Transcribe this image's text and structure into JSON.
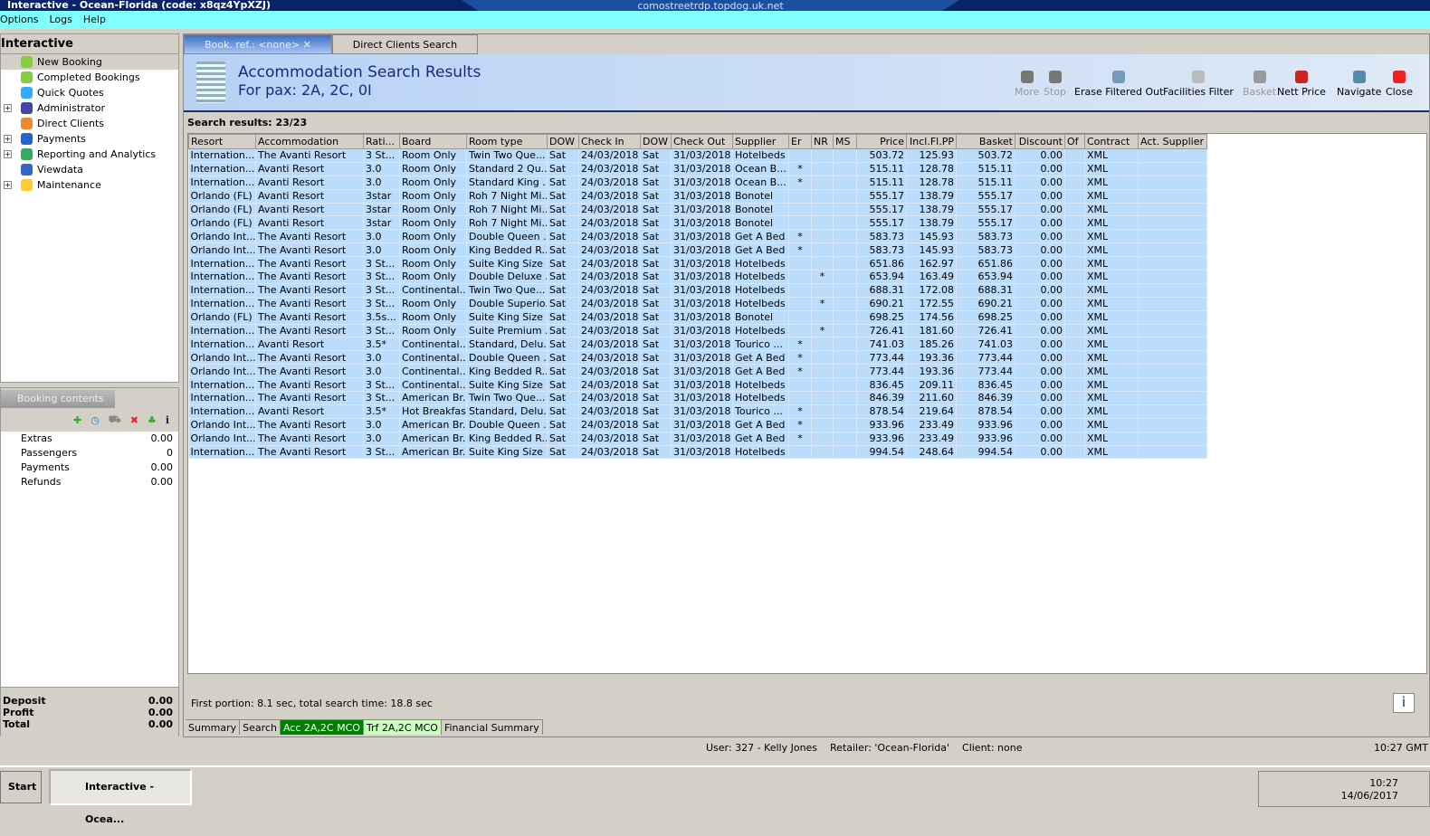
{
  "window": {
    "title": "Interactive - Ocean-Florida (code: x8qz4YpXZJ)",
    "rdp_host": "comostreetrdp.topdog.uk.net"
  },
  "menu": [
    "Options",
    "Logs",
    "Help"
  ],
  "left_panel": {
    "title": "Interactive",
    "items": [
      {
        "label": "New Booking",
        "expand": false
      },
      {
        "label": "Completed Bookings",
        "expand": false
      },
      {
        "label": "Quick Quotes",
        "expand": false
      },
      {
        "label": "Administrator",
        "expand": true
      },
      {
        "label": "Direct Clients",
        "expand": false
      },
      {
        "label": "Payments",
        "expand": true
      },
      {
        "label": "Reporting and Analytics",
        "expand": true
      },
      {
        "label": "Viewdata",
        "expand": false
      },
      {
        "label": "Maintenance",
        "expand": true
      }
    ]
  },
  "booking_contents": {
    "title": "Booking contents",
    "rows": [
      {
        "label": "Extras",
        "value": "0.00"
      },
      {
        "label": "Passengers",
        "value": "0"
      },
      {
        "label": "Payments",
        "value": "0.00"
      },
      {
        "label": "Refunds",
        "value": "0.00"
      }
    ],
    "footer": [
      {
        "label": "Deposit",
        "value": "0.00"
      },
      {
        "label": "Profit",
        "value": "0.00"
      },
      {
        "label": "Total",
        "value": "0.00"
      }
    ]
  },
  "tabs": [
    {
      "label": "Book. ref.: <none>"
    },
    {
      "label": "Direct Clients Search"
    }
  ],
  "header": {
    "title": "Accommodation Search Results",
    "subtitle": "For pax: 2A, 2C, 0I"
  },
  "toolbar": [
    {
      "label": "More",
      "disabled": true
    },
    {
      "label": "Stop",
      "disabled": true
    },
    {
      "label": "Erase Filtered Out",
      "disabled": false
    },
    {
      "label": "Facilities Filter",
      "disabled": false
    },
    {
      "label": "Basket",
      "disabled": true
    },
    {
      "label": "Nett Price",
      "disabled": false
    },
    {
      "label": "Navigate",
      "disabled": false
    },
    {
      "label": "Close",
      "disabled": false
    }
  ],
  "search_results": "Search results: 23/23",
  "columns": [
    "Resort",
    "Accommodation",
    "Rati...",
    "Board",
    "Room type",
    "DOW",
    "Check In",
    "DOW",
    "Check Out",
    "Supplier",
    "Er",
    "NR",
    "MS",
    "Price",
    "Incl.Fl.PP",
    "Basket",
    "Discount",
    "Of",
    "Contract",
    "Act. Supplier"
  ],
  "rows": [
    [
      "Internation...",
      "The Avanti Resort",
      "3 St...",
      "Room Only",
      "Twin Two Que...",
      "Sat",
      "24/03/2018",
      "Sat",
      "31/03/2018",
      "Hotelbeds",
      "",
      "",
      "",
      "503.72",
      "125.93",
      "503.72",
      "0.00",
      "",
      "XML",
      ""
    ],
    [
      "Internation...",
      "Avanti Resort",
      "3.0",
      "Room Only",
      "Standard 2 Qu...",
      "Sat",
      "24/03/2018",
      "Sat",
      "31/03/2018",
      "Ocean B...",
      "*",
      "",
      "",
      "515.11",
      "128.78",
      "515.11",
      "0.00",
      "",
      "XML",
      ""
    ],
    [
      "Internation...",
      "Avanti Resort",
      "3.0",
      "Room Only",
      "Standard King ...",
      "Sat",
      "24/03/2018",
      "Sat",
      "31/03/2018",
      "Ocean B...",
      "*",
      "",
      "",
      "515.11",
      "128.78",
      "515.11",
      "0.00",
      "",
      "XML",
      ""
    ],
    [
      "Orlando (FL)",
      "Avanti Resort",
      "3star",
      "Room Only",
      "Roh 7 Night Mi...",
      "Sat",
      "24/03/2018",
      "Sat",
      "31/03/2018",
      "Bonotel",
      "",
      "",
      "",
      "555.17",
      "138.79",
      "555.17",
      "0.00",
      "",
      "XML",
      ""
    ],
    [
      "Orlando (FL)",
      "Avanti Resort",
      "3star",
      "Room Only",
      "Roh 7 Night Mi...",
      "Sat",
      "24/03/2018",
      "Sat",
      "31/03/2018",
      "Bonotel",
      "",
      "",
      "",
      "555.17",
      "138.79",
      "555.17",
      "0.00",
      "",
      "XML",
      ""
    ],
    [
      "Orlando (FL)",
      "Avanti Resort",
      "3star",
      "Room Only",
      "Roh 7 Night Mi...",
      "Sat",
      "24/03/2018",
      "Sat",
      "31/03/2018",
      "Bonotel",
      "",
      "",
      "",
      "555.17",
      "138.79",
      "555.17",
      "0.00",
      "",
      "XML",
      ""
    ],
    [
      "Orlando Int...",
      "The Avanti Resort",
      "3.0",
      "Room Only",
      "Double Queen ...",
      "Sat",
      "24/03/2018",
      "Sat",
      "31/03/2018",
      "Get A Bed",
      "*",
      "",
      "",
      "583.73",
      "145.93",
      "583.73",
      "0.00",
      "",
      "XML",
      ""
    ],
    [
      "Orlando Int...",
      "The Avanti Resort",
      "3.0",
      "Room Only",
      "King Bedded R...",
      "Sat",
      "24/03/2018",
      "Sat",
      "31/03/2018",
      "Get A Bed",
      "*",
      "",
      "",
      "583.73",
      "145.93",
      "583.73",
      "0.00",
      "",
      "XML",
      ""
    ],
    [
      "Internation...",
      "The Avanti Resort",
      "3 St...",
      "Room Only",
      "Suite King Size ...",
      "Sat",
      "24/03/2018",
      "Sat",
      "31/03/2018",
      "Hotelbeds",
      "",
      "",
      "",
      "651.86",
      "162.97",
      "651.86",
      "0.00",
      "",
      "XML",
      ""
    ],
    [
      "Internation...",
      "The Avanti Resort",
      "3 St...",
      "Room Only",
      "Double Deluxe ...",
      "Sat",
      "24/03/2018",
      "Sat",
      "31/03/2018",
      "Hotelbeds",
      "",
      "*",
      "",
      "653.94",
      "163.49",
      "653.94",
      "0.00",
      "",
      "XML",
      ""
    ],
    [
      "Internation...",
      "The Avanti Resort",
      "3 St...",
      "Continental...",
      "Twin Two Que...",
      "Sat",
      "24/03/2018",
      "Sat",
      "31/03/2018",
      "Hotelbeds",
      "",
      "",
      "",
      "688.31",
      "172.08",
      "688.31",
      "0.00",
      "",
      "XML",
      ""
    ],
    [
      "Internation...",
      "The Avanti Resort",
      "3 St...",
      "Room Only",
      "Double Superio...",
      "Sat",
      "24/03/2018",
      "Sat",
      "31/03/2018",
      "Hotelbeds",
      "",
      "*",
      "",
      "690.21",
      "172.55",
      "690.21",
      "0.00",
      "",
      "XML",
      ""
    ],
    [
      "Orlando (FL)",
      "The Avanti Resort",
      "3.5s...",
      "Room Only",
      "Suite King Size ...",
      "Sat",
      "24/03/2018",
      "Sat",
      "31/03/2018",
      "Bonotel",
      "",
      "",
      "",
      "698.25",
      "174.56",
      "698.25",
      "0.00",
      "",
      "XML",
      ""
    ],
    [
      "Internation...",
      "The Avanti Resort",
      "3 St...",
      "Room Only",
      "Suite Premium ...",
      "Sat",
      "24/03/2018",
      "Sat",
      "31/03/2018",
      "Hotelbeds",
      "",
      "*",
      "",
      "726.41",
      "181.60",
      "726.41",
      "0.00",
      "",
      "XML",
      ""
    ],
    [
      "Internation...",
      "Avanti Resort",
      "3.5*",
      "Continental...",
      "Standard, Delu...",
      "Sat",
      "24/03/2018",
      "Sat",
      "31/03/2018",
      "Tourico ...",
      "*",
      "",
      "",
      "741.03",
      "185.26",
      "741.03",
      "0.00",
      "",
      "XML",
      ""
    ],
    [
      "Orlando Int...",
      "The Avanti Resort",
      "3.0",
      "Continental...",
      "Double Queen ...",
      "Sat",
      "24/03/2018",
      "Sat",
      "31/03/2018",
      "Get A Bed",
      "*",
      "",
      "",
      "773.44",
      "193.36",
      "773.44",
      "0.00",
      "",
      "XML",
      ""
    ],
    [
      "Orlando Int...",
      "The Avanti Resort",
      "3.0",
      "Continental...",
      "King Bedded R...",
      "Sat",
      "24/03/2018",
      "Sat",
      "31/03/2018",
      "Get A Bed",
      "*",
      "",
      "",
      "773.44",
      "193.36",
      "773.44",
      "0.00",
      "",
      "XML",
      ""
    ],
    [
      "Internation...",
      "The Avanti Resort",
      "3 St...",
      "Continental...",
      "Suite King Size ...",
      "Sat",
      "24/03/2018",
      "Sat",
      "31/03/2018",
      "Hotelbeds",
      "",
      "",
      "",
      "836.45",
      "209.11",
      "836.45",
      "0.00",
      "",
      "XML",
      ""
    ],
    [
      "Internation...",
      "The Avanti Resort",
      "3 St...",
      "American Br...",
      "Twin Two Que...",
      "Sat",
      "24/03/2018",
      "Sat",
      "31/03/2018",
      "Hotelbeds",
      "",
      "",
      "",
      "846.39",
      "211.60",
      "846.39",
      "0.00",
      "",
      "XML",
      ""
    ],
    [
      "Internation...",
      "Avanti Resort",
      "3.5*",
      "Hot Breakfast",
      "Standard, Delu...",
      "Sat",
      "24/03/2018",
      "Sat",
      "31/03/2018",
      "Tourico ...",
      "*",
      "",
      "",
      "878.54",
      "219.64",
      "878.54",
      "0.00",
      "",
      "XML",
      ""
    ],
    [
      "Orlando Int...",
      "The Avanti Resort",
      "3.0",
      "American Br...",
      "Double Queen ...",
      "Sat",
      "24/03/2018",
      "Sat",
      "31/03/2018",
      "Get A Bed",
      "*",
      "",
      "",
      "933.96",
      "233.49",
      "933.96",
      "0.00",
      "",
      "XML",
      ""
    ],
    [
      "Orlando Int...",
      "The Avanti Resort",
      "3.0",
      "American Br...",
      "King Bedded R...",
      "Sat",
      "24/03/2018",
      "Sat",
      "31/03/2018",
      "Get A Bed",
      "*",
      "",
      "",
      "933.96",
      "233.49",
      "933.96",
      "0.00",
      "",
      "XML",
      ""
    ],
    [
      "Internation...",
      "The Avanti Resort",
      "3 St...",
      "American Br...",
      "Suite King Size ...",
      "Sat",
      "24/03/2018",
      "Sat",
      "31/03/2018",
      "Hotelbeds",
      "",
      "",
      "",
      "994.54",
      "248.64",
      "994.54",
      "0.00",
      "",
      "XML",
      ""
    ]
  ],
  "timing": "First portion: 8.1 sec, total search time: 18.8 sec",
  "bottom_tabs": [
    {
      "label": "Summary"
    },
    {
      "label": "Search"
    },
    {
      "label": "Acc 2A,2C MCO",
      "color": "#008000"
    },
    {
      "label": "Trf 2A,2C MCO",
      "color": "#c8ffc0"
    },
    {
      "label": "Financial Summary"
    }
  ],
  "status": {
    "text": "User: 327 - Kelly Jones    Retailer: 'Ocean-Florida'    Client: none",
    "clock": "10:27 GMT"
  },
  "taskbar": {
    "start": "Start",
    "task": "Interactive - Ocea...",
    "time": "10:27",
    "date": "14/06/2017"
  }
}
